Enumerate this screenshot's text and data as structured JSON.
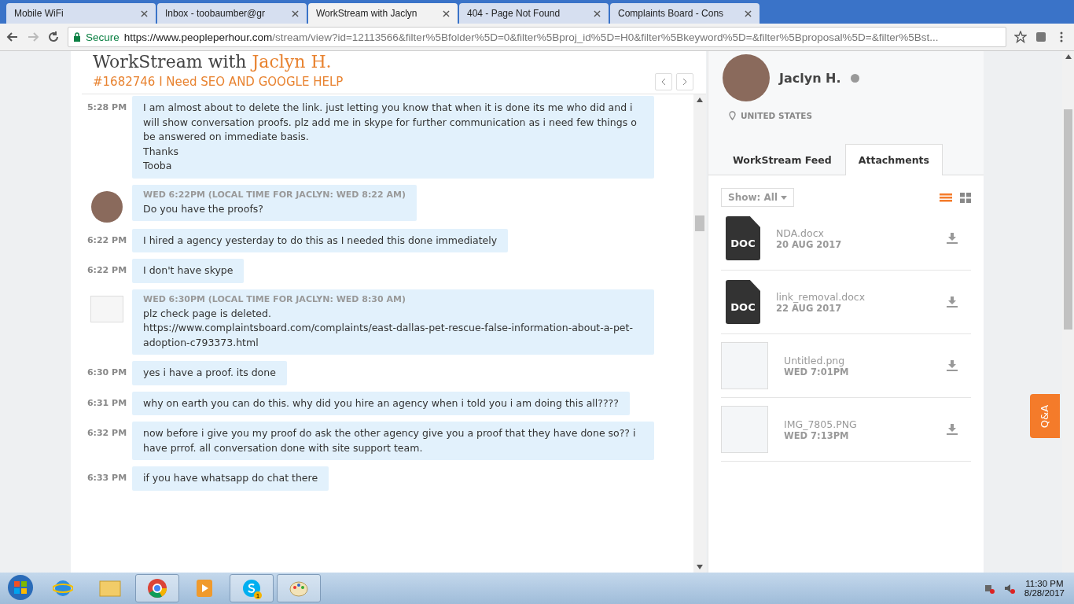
{
  "browser": {
    "tabs": [
      {
        "title": "Mobile WiFi",
        "selected": false
      },
      {
        "title": "Inbox - toobaumber@gr",
        "selected": false
      },
      {
        "title": "WorkStream with Jaclyn",
        "selected": true
      },
      {
        "title": "404 - Page Not Found",
        "selected": false
      },
      {
        "title": "Complaints Board - Cons",
        "selected": false
      }
    ],
    "secure_label": "Secure",
    "url_host": "https://www.peopleperhour.com",
    "url_path": "/stream/view?id=12113566&filter%5Bfolder%5D=0&filter%5Bproj_id%5D=H0&filter%5Bkeyword%5D=&filter%5Bproposal%5D=&filter%5Bst..."
  },
  "stream": {
    "title": "WorkStream with",
    "title_name": "Jaclyn H.",
    "project": "#1682746 I Need SEO AND GOOGLE HELP",
    "messages": [
      {
        "kind": "outgoing",
        "time": "5:28 PM",
        "text": "I am almost about to delete the link. just letting you know that when it is done its me who did and i will show conversation proofs. plz add me in skype for further communication as i need few things o be answered on immediate basis.\nThanks\nTooba"
      },
      {
        "kind": "incoming_photo",
        "header": "WED 6:22PM (LOCAL TIME FOR JACLYN: WED 8:22 AM)",
        "text": "Do you have the proofs?"
      },
      {
        "kind": "outgoing",
        "time": "6:22 PM",
        "text": "I hired a agency yesterday to do this as I needed this done immediately"
      },
      {
        "kind": "outgoing",
        "time": "6:22 PM",
        "text": "I don't have skype"
      },
      {
        "kind": "incoming_image",
        "header": "WED 6:30PM (LOCAL TIME FOR JACLYN: WED 8:30 AM)",
        "text": "plz check page is deleted.\nhttps://www.complaintsboard.com/complaints/east-dallas-pet-rescue-false-information-about-a-pet-adoption-c793373.html"
      },
      {
        "kind": "outgoing",
        "time": "6:30 PM",
        "text": "yes i have a proof. its done"
      },
      {
        "kind": "outgoing",
        "time": "6:31 PM",
        "text": "why on earth you can do this. why did you hire an agency when i told you i am doing this all????"
      },
      {
        "kind": "outgoing",
        "time": "6:32 PM",
        "text": "now before i give you my proof do ask the other agency give you a proof that they have done so?? i have prrof. all conversation done with site support team."
      },
      {
        "kind": "outgoing",
        "time": "6:33 PM",
        "text": "if you have whatsapp do chat there"
      }
    ]
  },
  "profile": {
    "name": "Jaclyn H.",
    "online": false,
    "location": "UNITED STATES",
    "tabs": [
      {
        "label": "WorkStream Feed",
        "selected": false
      },
      {
        "label": "Attachments",
        "selected": true
      }
    ],
    "filter": "Show: All",
    "view_modes": [
      {
        "kind": "list",
        "selected": true
      },
      {
        "kind": "grid",
        "selected": false
      }
    ],
    "attachments": [
      {
        "kind": "doc",
        "badge": "DOC",
        "name": "NDA.docx",
        "date": "20 AUG 2017"
      },
      {
        "kind": "doc",
        "badge": "DOC",
        "name": "link_removal.docx",
        "date": "22 AUG 2017"
      },
      {
        "kind": "image",
        "name": "Untitled.png",
        "date": "WED 7:01PM"
      },
      {
        "kind": "image",
        "name": "IMG_7805.PNG",
        "date": "WED 7:13PM"
      }
    ],
    "qa_button": "Q&A"
  },
  "taskbar": {
    "apps": [
      {
        "kind": "ie",
        "active": false
      },
      {
        "kind": "folder",
        "active": false
      },
      {
        "kind": "chrome",
        "active": true
      },
      {
        "kind": "media",
        "active": false
      },
      {
        "kind": "skype",
        "active": true,
        "badge": "1"
      },
      {
        "kind": "paint",
        "active": true
      }
    ],
    "time": "11:30 PM",
    "date": "8/28/2017"
  }
}
